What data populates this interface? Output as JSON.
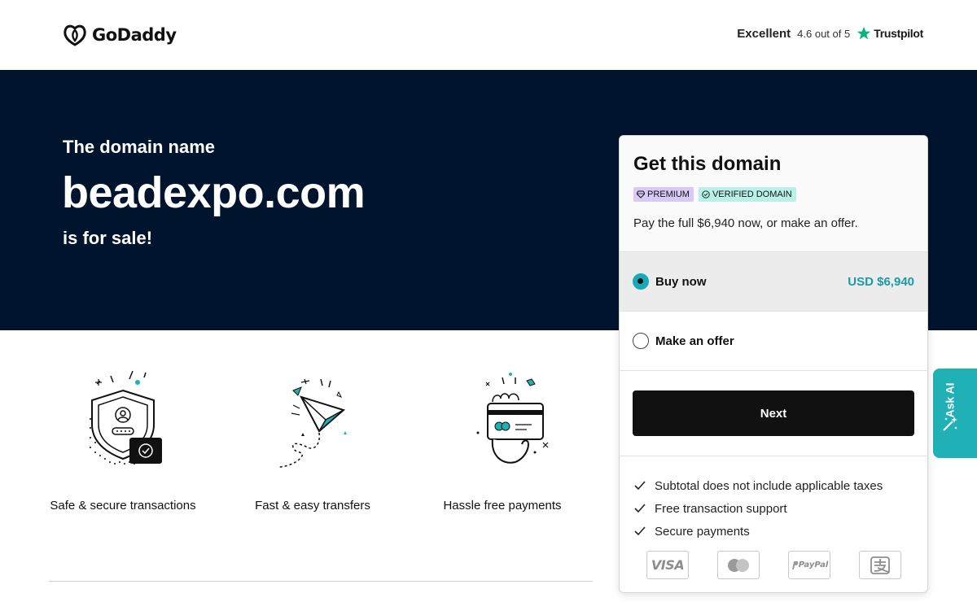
{
  "header": {
    "brand": "GoDaddy",
    "rating_word": "Excellent",
    "rating_score": "4.6 out of 5",
    "trustpilot": "Trustpilot"
  },
  "hero": {
    "lead": "The domain name",
    "domain": "beadexpo.com",
    "tail": "is for sale!"
  },
  "features": [
    {
      "caption": "Safe & secure transactions",
      "icon": "shield-icon"
    },
    {
      "caption": "Fast & easy transfers",
      "icon": "paper-plane-icon"
    },
    {
      "caption": "Hassle free payments",
      "icon": "card-payment-icon"
    }
  ],
  "card": {
    "title": "Get this domain",
    "badges": {
      "premium": "PREMIUM",
      "verified": "VERIFIED DOMAIN"
    },
    "note": "Pay the full $6,940 now, or make an offer.",
    "options": {
      "buy_label": "Buy now",
      "buy_price": "USD $6,940",
      "offer_label": "Make an offer",
      "selected": "Buy now"
    },
    "next_label": "Next",
    "checks": [
      "Subtotal does not include applicable taxes",
      "Free transaction support",
      "Secure payments"
    ],
    "payment_methods": {
      "visa": "VISA",
      "mastercard": "mastercard-icon",
      "paypal": "PayPal",
      "alipay": "alipay-icon"
    }
  },
  "ask_ai": {
    "label": "Ask AI"
  },
  "colors": {
    "hero_bg": "#00142d",
    "accent_teal": "#1a9aa8",
    "button_bg": "#111111",
    "premium_badge": "#d9c9f7",
    "verified_badge": "#b9f0ea",
    "trustpilot_star": "#00b67a"
  }
}
